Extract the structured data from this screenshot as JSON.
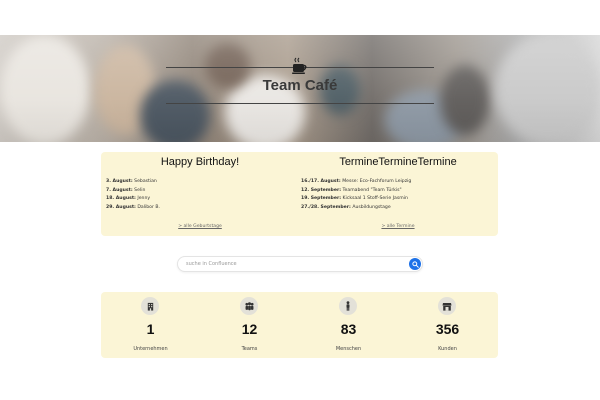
{
  "hero": {
    "icon": "coffee-cup-icon",
    "title": "Team Café"
  },
  "birthdays": {
    "title": "Happy Birthday!",
    "entries": [
      {
        "date": "3. August:",
        "name": "Sebastian"
      },
      {
        "date": "7. August:",
        "name": "Selin"
      },
      {
        "date": "18. August:",
        "name": "Jenny"
      },
      {
        "date": "29. August:",
        "name": "Dalibor B."
      }
    ],
    "link": "> alle Geburtstage"
  },
  "events": {
    "title": "TermineTermineTermine",
    "entries": [
      {
        "date": "16./17. August:",
        "name": "Messe: Eco-Fachforum Leipzig"
      },
      {
        "date": "12. September:",
        "name": "Teamabend \"Team Türkis\""
      },
      {
        "date": "19. September:",
        "name": "Kicksaal 1 Stoff-Serie Jasmin"
      },
      {
        "date": "27./28. September:",
        "name": "Ausbildungstage"
      }
    ],
    "link": "> alle Termine"
  },
  "search": {
    "placeholder": "suche in Confluence",
    "icon": "search-icon",
    "button_color": "#1e72e8"
  },
  "stats": [
    {
      "icon": "building-icon",
      "value": "1",
      "label": "Unternehmen"
    },
    {
      "icon": "people-icon",
      "value": "12",
      "label": "Teams"
    },
    {
      "icon": "person-icon",
      "value": "83",
      "label": "Menschen"
    },
    {
      "icon": "store-icon",
      "value": "356",
      "label": "Kunden"
    }
  ],
  "colors": {
    "panel_bg": "#fbf5d6",
    "icon_bg": "#e3e1d8"
  }
}
